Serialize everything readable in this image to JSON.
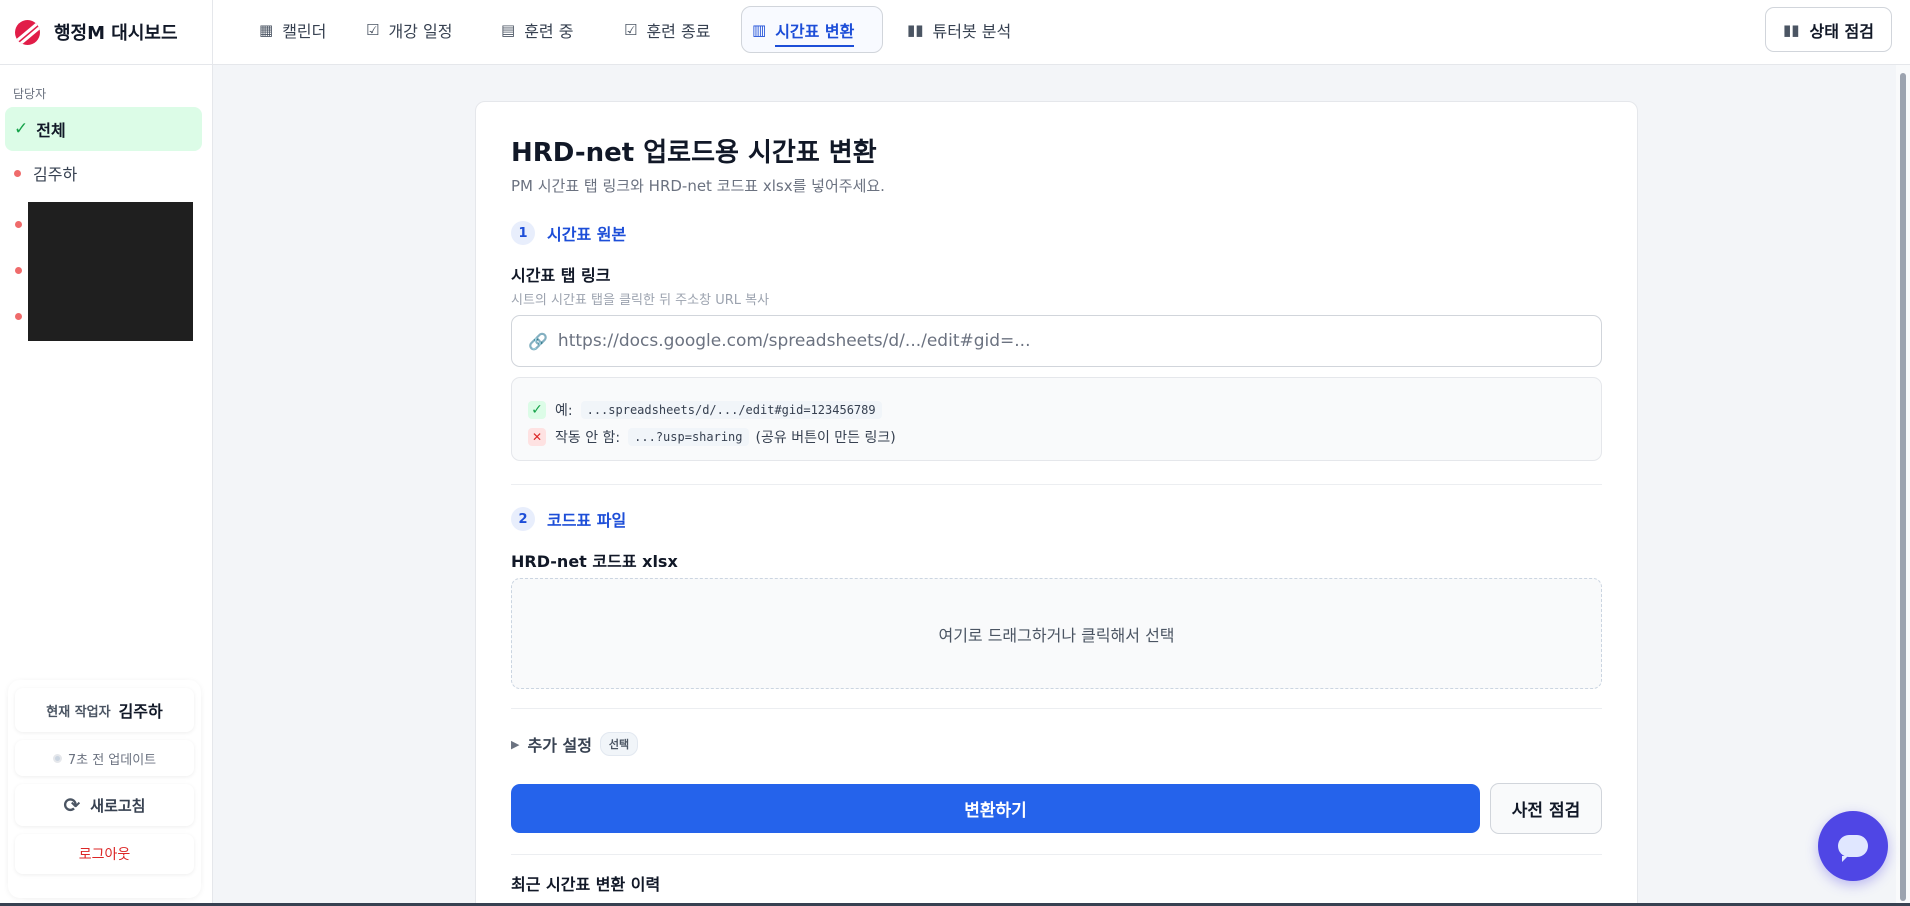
{
  "brand": {
    "name": "행정M 대시보드",
    "logo_icon": "brand-logo-icon"
  },
  "sidebar": {
    "section_label": "담당자",
    "items": [
      {
        "label": "전체",
        "active": true
      },
      {
        "label": "김주하",
        "active": false
      }
    ],
    "worker": {
      "label": "현재 작업자",
      "name": "김주하"
    },
    "update_status": "7초 전 업데이트",
    "refresh_label": "새로고침",
    "logout_label": "로그아웃"
  },
  "nav": {
    "tabs": [
      {
        "label": "캘린더",
        "icon": "calendar-icon"
      },
      {
        "label": "개강 일정",
        "icon": "clipboard-check-icon"
      },
      {
        "label": "훈련 중",
        "icon": "clipboard-icon"
      },
      {
        "label": "훈련 종료",
        "icon": "clipboard-check-icon"
      },
      {
        "label": "시간표 변환",
        "icon": "document-icon",
        "active": true
      },
      {
        "label": "튜터봇 분석",
        "icon": "bar-chart-icon"
      }
    ],
    "status_button": {
      "label": "상태 점검",
      "icon": "bar-chart-icon"
    }
  },
  "main": {
    "title": "HRD-net 업로드용 시간표 변환",
    "subtitle": "PM 시간표 탭 링크와 HRD-net 코드표 xlsx를 넣어주세요.",
    "step1": {
      "number": "1",
      "title": "시간표 원본",
      "field_label": "시간표 탭 링크",
      "field_hint": "시트의 시간표 탭을 클릭한 뒤 주소창 URL 복사",
      "placeholder": "https://docs.google.com/spreadsheets/d/.../edit#gid=...",
      "example_ok_label": "예:",
      "example_ok_code": "...spreadsheets/d/.../edit#gid=123456789",
      "example_bad_label": "작동 안 함:",
      "example_bad_code": "...?usp=sharing",
      "example_bad_note": "(공유 버튼이 만든 링크)"
    },
    "step2": {
      "number": "2",
      "title": "코드표 파일",
      "field_label": "HRD-net 코드표 xlsx",
      "dropzone_text": "여기로 드래그하거나 클릭해서 선택"
    },
    "advanced": {
      "label": "추가 설정",
      "badge": "선택"
    },
    "convert_label": "변환하기",
    "precheck_label": "사전 점검",
    "history_title": "최근 시간표 변환 이력"
  },
  "colors": {
    "accent": "#2563eb",
    "active_tab": "#1d4ed8",
    "sidebar_active_bg": "#dcfce7",
    "danger": "#dc2626",
    "chat_fab": "#4f46e5"
  }
}
